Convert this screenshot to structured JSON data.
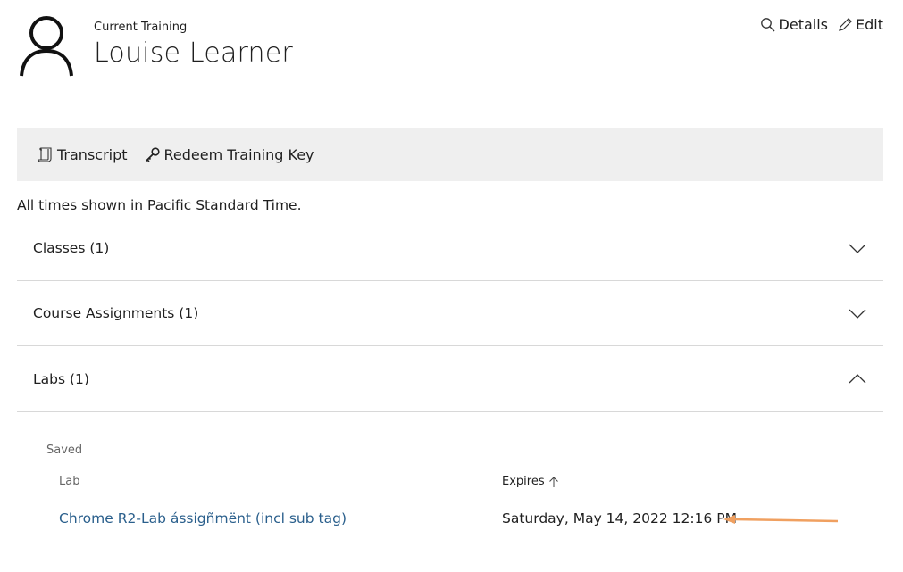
{
  "header": {
    "subtitle": "Current Training",
    "title": "Louise Learner",
    "details_label": "Details",
    "edit_label": "Edit"
  },
  "toolbar": {
    "transcript_label": "Transcript",
    "redeem_label": "Redeem Training Key"
  },
  "timezone_note": "All times shown in Pacific Standard Time.",
  "sections": [
    {
      "label": "Classes (1)",
      "expanded": false
    },
    {
      "label": "Course Assignments (1)",
      "expanded": false
    },
    {
      "label": "Labs (1)",
      "expanded": true
    }
  ],
  "labs": {
    "group_label": "Saved",
    "columns": {
      "lab": "Lab",
      "expires": "Expires"
    },
    "rows": [
      {
        "name": "Chrome R2-Lab ássigñmënt (incl sub tag)",
        "expires": "Saturday, May 14, 2022 12:16 PM"
      }
    ]
  },
  "colors": {
    "toolbar_bg": "#efefef",
    "link": "#2a5f8c",
    "annotation_arrow": "#f0a060"
  },
  "icons": [
    "avatar-icon",
    "search-icon",
    "pencil-icon",
    "scroll-icon",
    "key-icon",
    "chevron-down-icon",
    "chevron-up-icon",
    "sort-up-icon",
    "annotation-arrow"
  ]
}
